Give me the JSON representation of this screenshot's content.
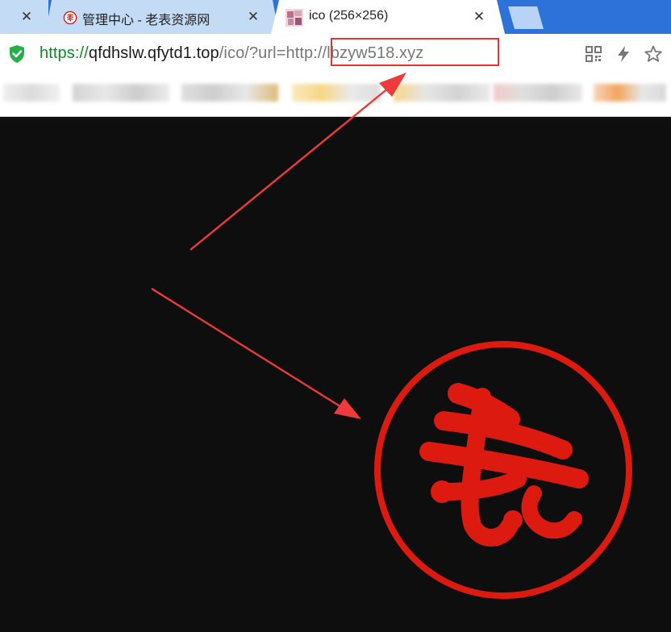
{
  "tabs": [
    {
      "title": "",
      "close": "✕"
    },
    {
      "title": "管理中心 - 老表资源网",
      "close": "✕"
    },
    {
      "title": "ico (256×256)",
      "close": "✕"
    }
  ],
  "address_bar": {
    "url_scheme": "https://",
    "url_host": "qfdhslw.qfytd1.top",
    "url_path": "/ico/?url=",
    "url_param": "http://lbzyw518.xyz"
  },
  "toolbar_icons": [
    "qr-code-icon",
    "lightning-icon",
    "star-icon"
  ],
  "colors": {
    "tab_strip": "#2c72d8",
    "highlight": "#e53232",
    "logo_red": "#dd1a10",
    "background": "#0e0e0e"
  }
}
